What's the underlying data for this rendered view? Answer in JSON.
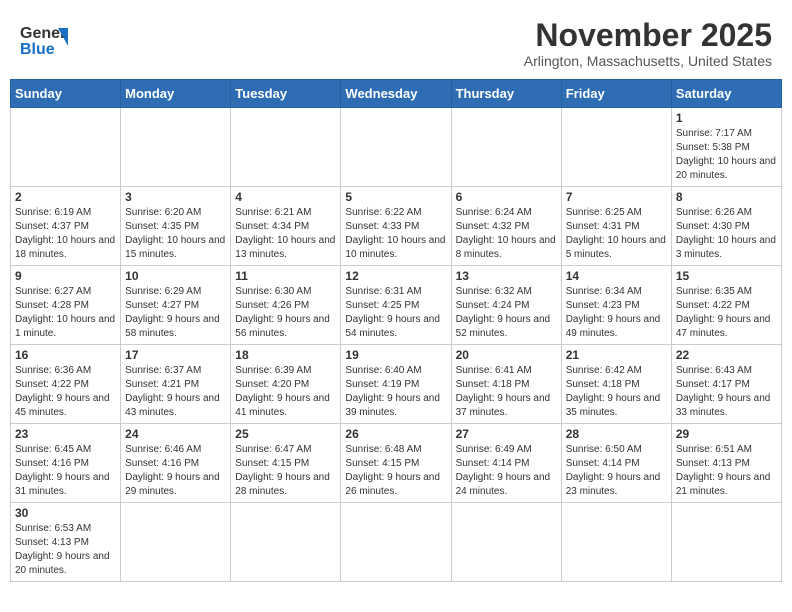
{
  "header": {
    "logo_general": "General",
    "logo_blue": "Blue",
    "month_title": "November 2025",
    "location": "Arlington, Massachusetts, United States"
  },
  "days_of_week": [
    "Sunday",
    "Monday",
    "Tuesday",
    "Wednesday",
    "Thursday",
    "Friday",
    "Saturday"
  ],
  "weeks": [
    [
      {
        "day": "",
        "info": ""
      },
      {
        "day": "",
        "info": ""
      },
      {
        "day": "",
        "info": ""
      },
      {
        "day": "",
        "info": ""
      },
      {
        "day": "",
        "info": ""
      },
      {
        "day": "",
        "info": ""
      },
      {
        "day": "1",
        "info": "Sunrise: 7:17 AM\nSunset: 5:38 PM\nDaylight: 10 hours and 20 minutes."
      }
    ],
    [
      {
        "day": "2",
        "info": "Sunrise: 6:19 AM\nSunset: 4:37 PM\nDaylight: 10 hours and 18 minutes."
      },
      {
        "day": "3",
        "info": "Sunrise: 6:20 AM\nSunset: 4:35 PM\nDaylight: 10 hours and 15 minutes."
      },
      {
        "day": "4",
        "info": "Sunrise: 6:21 AM\nSunset: 4:34 PM\nDaylight: 10 hours and 13 minutes."
      },
      {
        "day": "5",
        "info": "Sunrise: 6:22 AM\nSunset: 4:33 PM\nDaylight: 10 hours and 10 minutes."
      },
      {
        "day": "6",
        "info": "Sunrise: 6:24 AM\nSunset: 4:32 PM\nDaylight: 10 hours and 8 minutes."
      },
      {
        "day": "7",
        "info": "Sunrise: 6:25 AM\nSunset: 4:31 PM\nDaylight: 10 hours and 5 minutes."
      },
      {
        "day": "8",
        "info": "Sunrise: 6:26 AM\nSunset: 4:30 PM\nDaylight: 10 hours and 3 minutes."
      }
    ],
    [
      {
        "day": "9",
        "info": "Sunrise: 6:27 AM\nSunset: 4:28 PM\nDaylight: 10 hours and 1 minute."
      },
      {
        "day": "10",
        "info": "Sunrise: 6:29 AM\nSunset: 4:27 PM\nDaylight: 9 hours and 58 minutes."
      },
      {
        "day": "11",
        "info": "Sunrise: 6:30 AM\nSunset: 4:26 PM\nDaylight: 9 hours and 56 minutes."
      },
      {
        "day": "12",
        "info": "Sunrise: 6:31 AM\nSunset: 4:25 PM\nDaylight: 9 hours and 54 minutes."
      },
      {
        "day": "13",
        "info": "Sunrise: 6:32 AM\nSunset: 4:24 PM\nDaylight: 9 hours and 52 minutes."
      },
      {
        "day": "14",
        "info": "Sunrise: 6:34 AM\nSunset: 4:23 PM\nDaylight: 9 hours and 49 minutes."
      },
      {
        "day": "15",
        "info": "Sunrise: 6:35 AM\nSunset: 4:22 PM\nDaylight: 9 hours and 47 minutes."
      }
    ],
    [
      {
        "day": "16",
        "info": "Sunrise: 6:36 AM\nSunset: 4:22 PM\nDaylight: 9 hours and 45 minutes."
      },
      {
        "day": "17",
        "info": "Sunrise: 6:37 AM\nSunset: 4:21 PM\nDaylight: 9 hours and 43 minutes."
      },
      {
        "day": "18",
        "info": "Sunrise: 6:39 AM\nSunset: 4:20 PM\nDaylight: 9 hours and 41 minutes."
      },
      {
        "day": "19",
        "info": "Sunrise: 6:40 AM\nSunset: 4:19 PM\nDaylight: 9 hours and 39 minutes."
      },
      {
        "day": "20",
        "info": "Sunrise: 6:41 AM\nSunset: 4:18 PM\nDaylight: 9 hours and 37 minutes."
      },
      {
        "day": "21",
        "info": "Sunrise: 6:42 AM\nSunset: 4:18 PM\nDaylight: 9 hours and 35 minutes."
      },
      {
        "day": "22",
        "info": "Sunrise: 6:43 AM\nSunset: 4:17 PM\nDaylight: 9 hours and 33 minutes."
      }
    ],
    [
      {
        "day": "23",
        "info": "Sunrise: 6:45 AM\nSunset: 4:16 PM\nDaylight: 9 hours and 31 minutes."
      },
      {
        "day": "24",
        "info": "Sunrise: 6:46 AM\nSunset: 4:16 PM\nDaylight: 9 hours and 29 minutes."
      },
      {
        "day": "25",
        "info": "Sunrise: 6:47 AM\nSunset: 4:15 PM\nDaylight: 9 hours and 28 minutes."
      },
      {
        "day": "26",
        "info": "Sunrise: 6:48 AM\nSunset: 4:15 PM\nDaylight: 9 hours and 26 minutes."
      },
      {
        "day": "27",
        "info": "Sunrise: 6:49 AM\nSunset: 4:14 PM\nDaylight: 9 hours and 24 minutes."
      },
      {
        "day": "28",
        "info": "Sunrise: 6:50 AM\nSunset: 4:14 PM\nDaylight: 9 hours and 23 minutes."
      },
      {
        "day": "29",
        "info": "Sunrise: 6:51 AM\nSunset: 4:13 PM\nDaylight: 9 hours and 21 minutes."
      }
    ],
    [
      {
        "day": "30",
        "info": "Sunrise: 6:53 AM\nSunset: 4:13 PM\nDaylight: 9 hours and 20 minutes."
      },
      {
        "day": "",
        "info": ""
      },
      {
        "day": "",
        "info": ""
      },
      {
        "day": "",
        "info": ""
      },
      {
        "day": "",
        "info": ""
      },
      {
        "day": "",
        "info": ""
      },
      {
        "day": "",
        "info": ""
      }
    ]
  ]
}
